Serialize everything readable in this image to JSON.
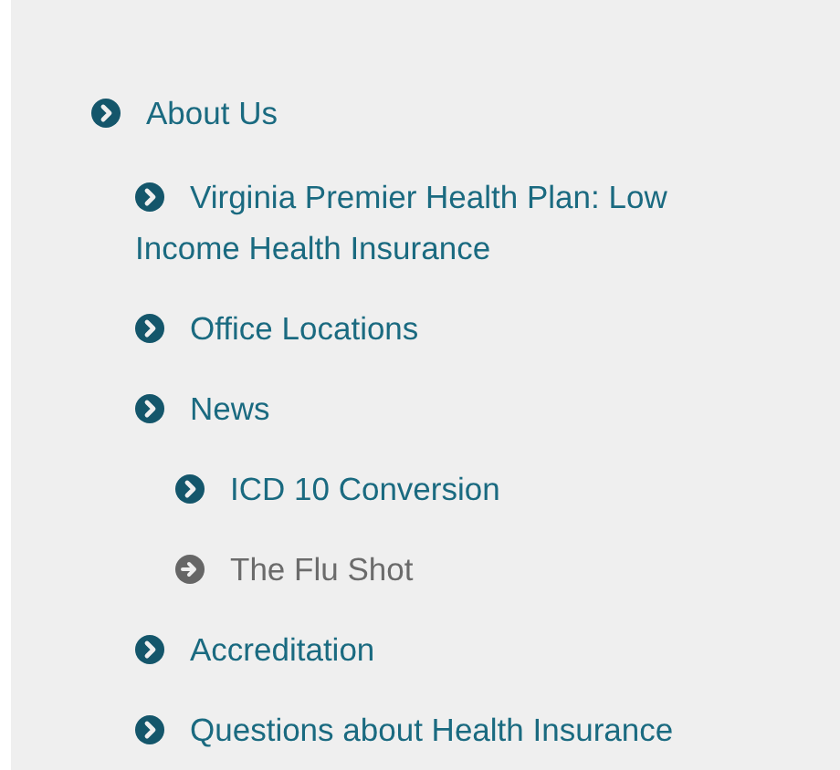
{
  "menu": [
    {
      "label": "About Us",
      "selected": false,
      "children": [
        {
          "label": "Virginia Premier Health Plan: Low Income Health Insurance",
          "selected": false
        },
        {
          "label": "Office Locations",
          "selected": false
        },
        {
          "label": "News",
          "selected": false,
          "children": [
            {
              "label": "ICD 10 Conversion",
              "selected": false
            },
            {
              "label": "The Flu Shot",
              "selected": true
            }
          ]
        },
        {
          "label": "Accreditation",
          "selected": false
        },
        {
          "label": "Questions about Health Insurance",
          "selected": false
        }
      ]
    }
  ]
}
